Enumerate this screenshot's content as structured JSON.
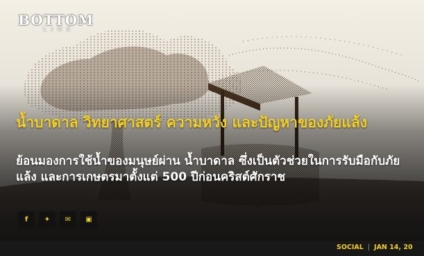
{
  "logo": {
    "main": "BOTTOM",
    "sub": "LINE"
  },
  "article": {
    "headline": "น้ำบาดาล วิทยาศาสตร์ ความหวัง และปัญหาของภัยแล้ง",
    "subtitle": "ย้อนมองการใช้น้ำของมนุษย์ผ่าน น้ำบาดาล ซึ่งเป็นตัวช่วยในการรับมือกับภัยแล้ง และการเกษตรมาตั้งแต่ 500 ปีก่อนคริสต์ศักราช"
  },
  "share": {
    "facebook": "f",
    "twitter": "✦",
    "email": "✉",
    "line": "▣"
  },
  "meta": {
    "category": "SOCIAL",
    "date": "JAN 14, 20"
  },
  "colors": {
    "accent": "#f4cf23",
    "dark": "#181818"
  }
}
